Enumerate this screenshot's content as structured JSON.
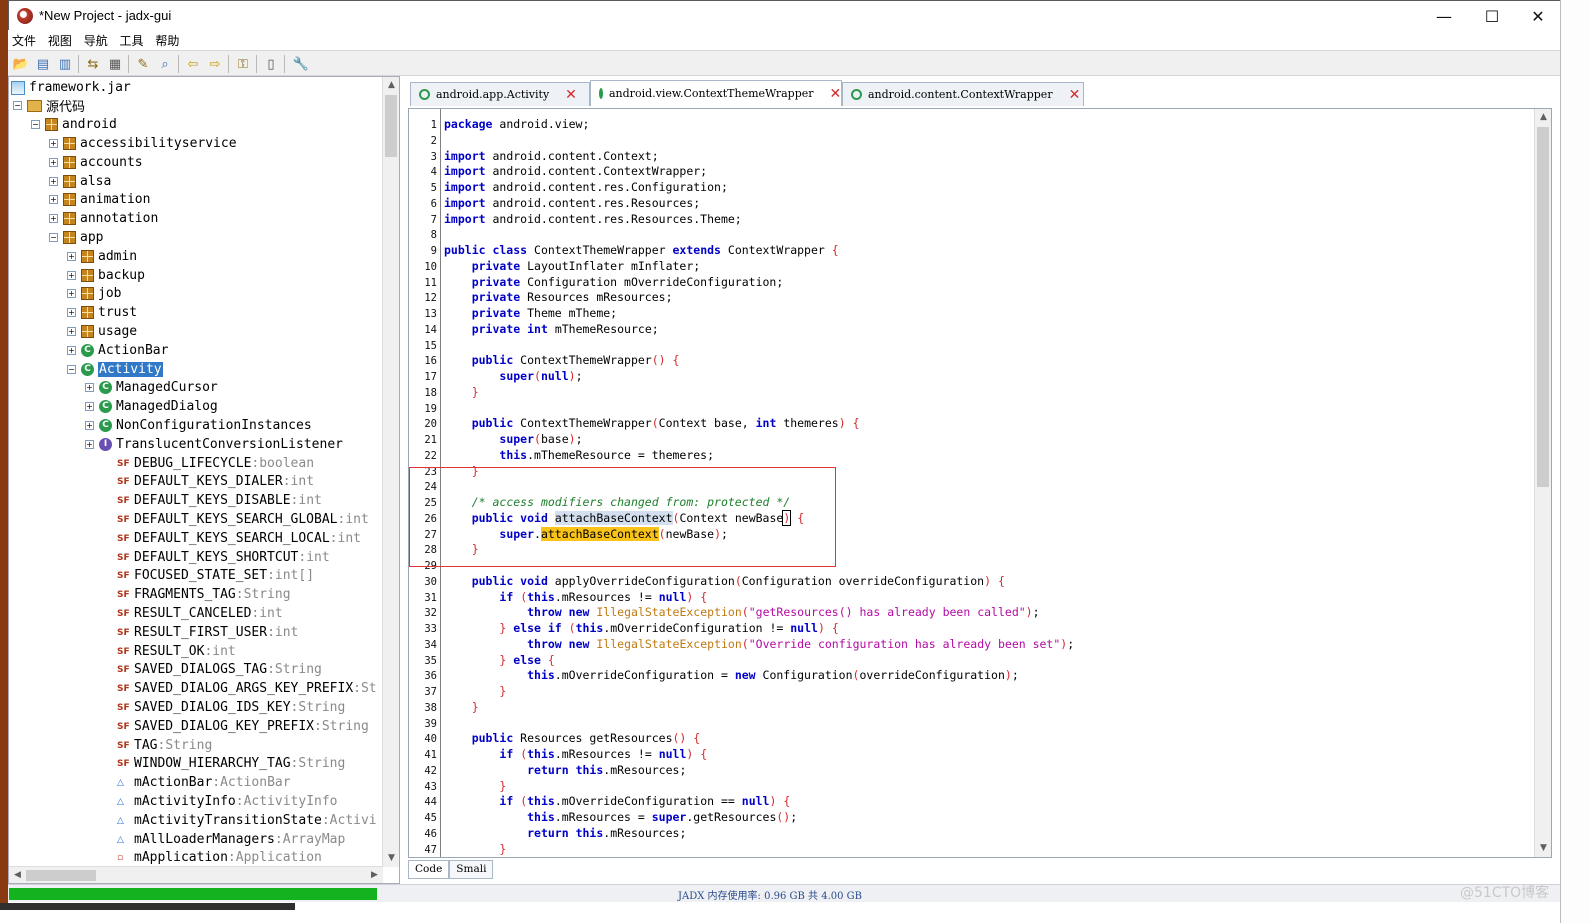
{
  "window": {
    "title": "*New Project - jadx-gui",
    "minimize": "—",
    "maximize": "☐",
    "close": "✕"
  },
  "menu": [
    "文件",
    "视图",
    "导航",
    "工具",
    "帮助"
  ],
  "toolbar_icons": [
    "open-icon",
    "save-icon",
    "save-all-icon",
    "sync-icon",
    "flatten-icon",
    "decompile-icon",
    "search-icon",
    "back-icon",
    "forward-icon",
    "deobfuscation-icon",
    "log-icon",
    "preferences-icon"
  ],
  "tree": {
    "root": "framework.jar",
    "source": "源代码",
    "android": "android",
    "packages": [
      "accessibilityservice",
      "accounts",
      "alsa",
      "animation",
      "annotation",
      "app"
    ],
    "app_children": [
      "admin",
      "backup",
      "job",
      "trust",
      "usage"
    ],
    "classes": [
      "ActionBar",
      "Activity"
    ],
    "activity_children": [
      "ManagedCursor",
      "ManagedDialog",
      "NonConfigurationInstances",
      "TranslucentConversionListener"
    ],
    "fields": [
      {
        "name": "DEBUG_LIFECYCLE",
        "type": "boolean"
      },
      {
        "name": "DEFAULT_KEYS_DIALER",
        "type": "int"
      },
      {
        "name": "DEFAULT_KEYS_DISABLE",
        "type": "int"
      },
      {
        "name": "DEFAULT_KEYS_SEARCH_GLOBAL",
        "type": "int"
      },
      {
        "name": "DEFAULT_KEYS_SEARCH_LOCAL",
        "type": "int"
      },
      {
        "name": "DEFAULT_KEYS_SHORTCUT",
        "type": "int"
      },
      {
        "name": "FOCUSED_STATE_SET",
        "type": "int[]"
      },
      {
        "name": "FRAGMENTS_TAG",
        "type": "String"
      },
      {
        "name": "RESULT_CANCELED",
        "type": "int"
      },
      {
        "name": "RESULT_FIRST_USER",
        "type": "int"
      },
      {
        "name": "RESULT_OK",
        "type": "int"
      },
      {
        "name": "SAVED_DIALOGS_TAG",
        "type": "String"
      },
      {
        "name": "SAVED_DIALOG_ARGS_KEY_PREFIX",
        "type": "St"
      },
      {
        "name": "SAVED_DIALOG_IDS_KEY",
        "type": "String"
      },
      {
        "name": "SAVED_DIALOG_KEY_PREFIX",
        "type": "String"
      },
      {
        "name": "TAG",
        "type": "String"
      },
      {
        "name": "WINDOW_HIERARCHY_TAG",
        "type": "String"
      },
      {
        "name": "mActionBar",
        "type": "ActionBar"
      },
      {
        "name": "mActivityInfo",
        "type": "ActivityInfo"
      },
      {
        "name": "mActivityTransitionState",
        "type": "Activi"
      },
      {
        "name": "mAllLoaderManagers",
        "type": "ArrayMap"
      },
      {
        "name": "mApplication",
        "type": "Application"
      }
    ],
    "type_separator": " : "
  },
  "tabs": [
    {
      "label": "android.app.Activity",
      "active": false
    },
    {
      "label": "android.view.ContextThemeWrapper",
      "active": true
    },
    {
      "label": "android.content.ContextWrapper",
      "active": false
    }
  ],
  "code_lines": [
    "1",
    "2",
    "3",
    "4",
    "5",
    "6",
    "7",
    "8",
    "9",
    "10",
    "11",
    "12",
    "13",
    "14",
    "15",
    "16",
    "17",
    "18",
    "19",
    "20",
    "21",
    "22",
    "23",
    "24",
    "25",
    "26",
    "27",
    "28",
    "29",
    "30",
    "31",
    "32",
    "33",
    "34",
    "35",
    "36",
    "37",
    "38",
    "39",
    "40",
    "41",
    "42",
    "43",
    "44",
    "45",
    "46",
    "47"
  ],
  "code": {
    "l1": "android.view;",
    "imports": [
      "android.content.Context;",
      "android.content.ContextWrapper;",
      "android.content.res.Configuration;",
      "android.content.res.Resources;",
      "android.content.res.Resources.Theme;"
    ],
    "class_name": "ContextThemeWrapper",
    "super_name": "ContextWrapper",
    "fields": [
      "LayoutInflater mInflater;",
      "Configuration mOverrideConfiguration;",
      "Resources mResources;",
      "Theme mTheme;"
    ],
    "field_int": "mThemeResource;",
    "comment": "/* access modifiers changed from: protected */",
    "method_name": "attachBaseContext",
    "str1": "\"getResources() has already been called\"",
    "str2": "\"Override configuration has already been set\"",
    "exception": "IllegalStateException"
  },
  "bottom_tabs": [
    "Code",
    "Smali"
  ],
  "status": {
    "memory": "JADX 内存使用率: 0.96 GB 共 4.00 GB",
    "progress": 1.0
  },
  "watermark": "@51CTO博客"
}
